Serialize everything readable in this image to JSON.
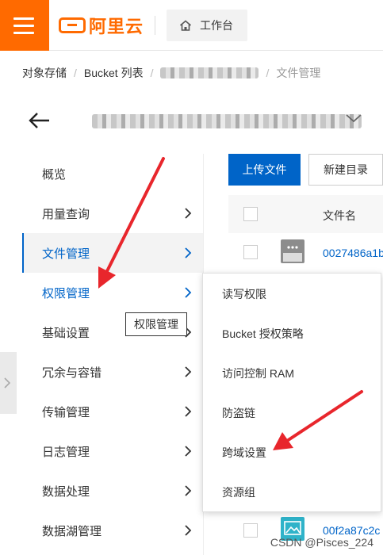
{
  "header": {
    "logo_text": "阿里云",
    "workbench_label": "工作台"
  },
  "breadcrumb": {
    "items": [
      "对象存储",
      "Bucket 列表"
    ],
    "current": "文件管理"
  },
  "sidebar": {
    "items": [
      {
        "label": "概览"
      },
      {
        "label": "用量查询"
      },
      {
        "label": "文件管理"
      },
      {
        "label": "权限管理"
      },
      {
        "label": "基础设置"
      },
      {
        "label": "冗余与容错"
      },
      {
        "label": "传输管理"
      },
      {
        "label": "日志管理"
      },
      {
        "label": "数据处理"
      },
      {
        "label": "数据湖管理"
      }
    ]
  },
  "tooltip": "权限管理",
  "toolbar": {
    "upload_label": "上传文件",
    "newdir_label": "新建目录"
  },
  "table": {
    "column_name": "文件名",
    "rows": [
      {
        "name": "0027486a1b"
      },
      {
        "name": "00f2a87c2c"
      }
    ]
  },
  "dropdown": {
    "items": [
      {
        "label": "读写权限"
      },
      {
        "label": "Bucket 授权策略"
      },
      {
        "label": "访问控制 RAM"
      },
      {
        "label": "防盗链"
      },
      {
        "label": "跨域设置"
      },
      {
        "label": "资源组"
      }
    ]
  },
  "watermark": "CSDN @Pisces_224",
  "colors": {
    "brand_orange": "#ff6a00",
    "primary_blue": "#0064c8",
    "annotation_red": "#e8262c"
  }
}
